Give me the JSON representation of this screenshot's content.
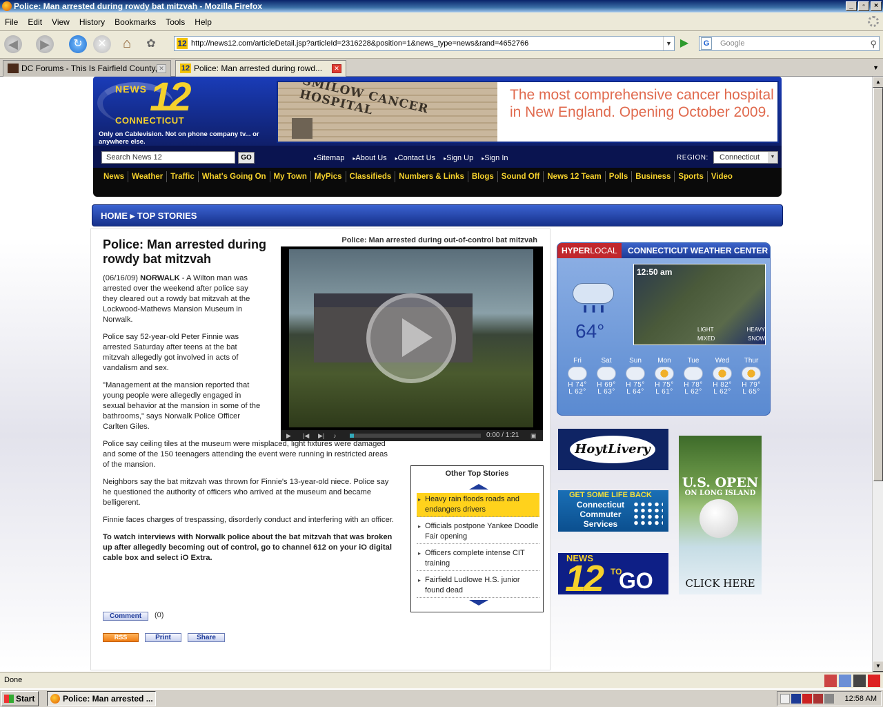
{
  "window": {
    "title": "Police: Man arrested during rowdy bat mitzvah - Mozilla Firefox",
    "controls": [
      "_",
      "▫",
      "×"
    ]
  },
  "menu": [
    "File",
    "Edit",
    "View",
    "History",
    "Bookmarks",
    "Tools",
    "Help"
  ],
  "nav": {
    "url": "http://news12.com/articleDetail.jsp?articleId=2316228&position=1&news_type=news&rand=4652766",
    "search_placeholder": "Google",
    "favicon_label": "12"
  },
  "tabs": [
    {
      "label": "DC Forums - This Is Fairfield County, ...",
      "active": false
    },
    {
      "label": "Police: Man arrested during rowd...",
      "active": true
    }
  ],
  "site": {
    "logo_news": "NEWS",
    "logo_number": "12",
    "logo_region": "CONNECTICUT",
    "tagline": "Only on Cablevision. Not on phone company tv... or anywhere else.",
    "banner_ad": {
      "building_name": "SMILOW CANCER HOSPITAL",
      "text": "The most comprehensive cancer hospital in New England. Opening October 2009."
    },
    "search_value": "Search News 12",
    "search_go": "GO",
    "top_links": [
      "Sitemap",
      "About Us",
      "Contact Us",
      "Sign Up",
      "Sign In"
    ],
    "region_label": "REGION:",
    "region_value": "Connecticut",
    "nav_items": [
      "News",
      "Weather",
      "Traffic",
      "What's Going On",
      "My Town",
      "MyPics",
      "Classifieds",
      "Numbers & Links",
      "Blogs",
      "Sound Off",
      "News 12 Team",
      "Polls",
      "Business",
      "Sports",
      "Video"
    ],
    "breadcrumb": "HOME ▸ TOP STORIES"
  },
  "article": {
    "title": "Police: Man arrested during rowdy bat mitzvah",
    "video_title": "Police: Man arrested during out-of-control bat mitzvah",
    "video_time": "0:00 / 1:21",
    "video_progress": 0.03,
    "date": "(06/16/09)",
    "dateline": "NORWALK",
    "p1": " - A Wilton man was arrested over the weekend after police say they cleared out a rowdy bat mitzvah at the Lockwood-Mathews Mansion Museum in Norwalk.",
    "p2": "Police say 52-year-old Peter Finnie was arrested Saturday after teens at the bat mitzvah allegedly got involved in acts of vandalism and sex.",
    "p3": "\"Management at the mansion reported that young people were allegedly engaged in sexual behavior at the mansion in some of the bathrooms,\" says Norwalk Police Officer Carlten Giles.",
    "p4": "Police say ceiling tiles at the museum were misplaced, light fixtures were damaged and some of the 150 teenagers attending the event were running in restricted areas of the mansion.",
    "p5": "Neighbors say the bat mitzvah was thrown for Finnie's 13-year-old niece. Police say he questioned the authority of officers who arrived at the museum and became belligerent.",
    "p6": "Finnie faces charges of trespassing, disorderly conduct and interfering with an officer.",
    "p7": "To watch interviews with Norwalk police about the bat mitzvah that was broken up after allegedly becoming out of control, go to channel 612 on your iO digital cable box and select iO Extra.",
    "comment_label": "Comment",
    "comment_count": "(0)",
    "rss_label": "RSS",
    "print_label": "Print",
    "share_label": "Share"
  },
  "other_stories": {
    "title": "Other Top Stories",
    "items": [
      "Heavy rain floods roads and endangers drivers",
      "Officials postpone Yankee Doodle Fair opening",
      "Officers complete intense CIT training",
      "Fairfield Ludlowe H.S. junior found dead"
    ]
  },
  "weather": {
    "hyper": "HYPER",
    "local": "LOCAL",
    "title": "CONNECTICUT WEATHER CENTER",
    "current_temp": "64°",
    "map_time": "12:50 am",
    "legend_light": "LIGHT",
    "legend_heavy": "HEAVY",
    "legend_mixed": "MIXED",
    "legend_snow": "SNOW",
    "forecast": [
      {
        "day": "Fri",
        "hi": "H 74°",
        "lo": "L 62°",
        "icon": "cloud"
      },
      {
        "day": "Sat",
        "hi": "H 69°",
        "lo": "L 63°",
        "icon": "cloud"
      },
      {
        "day": "Sun",
        "hi": "H 75°",
        "lo": "L 64°",
        "icon": "cloud"
      },
      {
        "day": "Mon",
        "hi": "H 75°",
        "lo": "L 61°",
        "icon": "sun"
      },
      {
        "day": "Tue",
        "hi": "H 78°",
        "lo": "L 62°",
        "icon": "cloud"
      },
      {
        "day": "Wed",
        "hi": "H 82°",
        "lo": "L 62°",
        "icon": "sun"
      },
      {
        "day": "Thur",
        "hi": "H 79°",
        "lo": "L 65°",
        "icon": "sun"
      }
    ]
  },
  "ads": {
    "limo": "HoytLivery",
    "commuter_top": "GET SOME LIFE BACK",
    "commuter_main": "Connecticut Commuter Services",
    "togo_news": "NEWS",
    "togo_num": "12",
    "togo_to": "TO",
    "togo_go": "GO",
    "usopen": "U.S. OPEN",
    "usopen_sub": "ON LONG ISLAND",
    "click": "CLICK HERE"
  },
  "status": "Done",
  "taskbar": {
    "start": "Start",
    "item": "Police: Man arrested ...",
    "clock": "12:58 AM"
  }
}
